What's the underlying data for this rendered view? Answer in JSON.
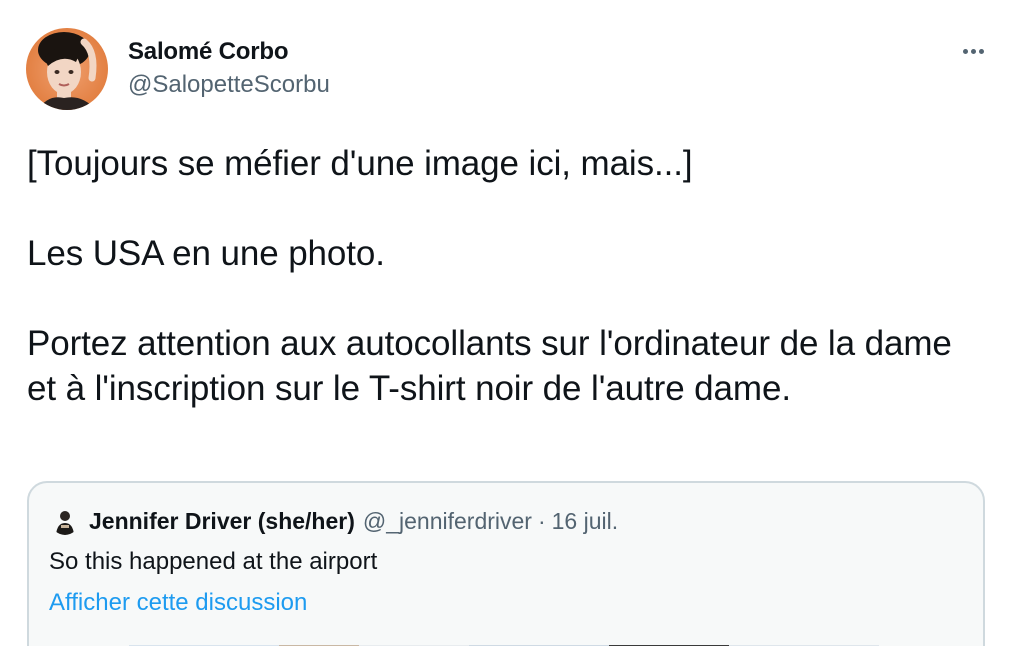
{
  "author": {
    "display_name": "Salomé Corbo",
    "handle": "@SalopetteScorbu",
    "avatar_icon": "profile-photo"
  },
  "more_menu_icon": "more-horizontal-icon",
  "tweet": {
    "lines": [
      "[Toujours se méfier d'une image ici, mais...]",
      "Les USA en une photo.",
      "Portez attention aux autocollants sur l'ordinateur de la dame et à l'inscription sur le T-shirt noir de l'autre dame."
    ]
  },
  "quoted_tweet": {
    "display_name": "Jennifer Driver (she/her)",
    "handle": "@_jenniferdriver",
    "separator": "·",
    "date": "16 juil.",
    "text": "So this happened at the airport",
    "thread_link": "Afficher cette discussion"
  },
  "colors": {
    "text_primary": "#0f1419",
    "text_secondary": "#536471",
    "link": "#1d9bf0",
    "border": "#cfd9de",
    "quote_background": "#f7f9f9"
  }
}
